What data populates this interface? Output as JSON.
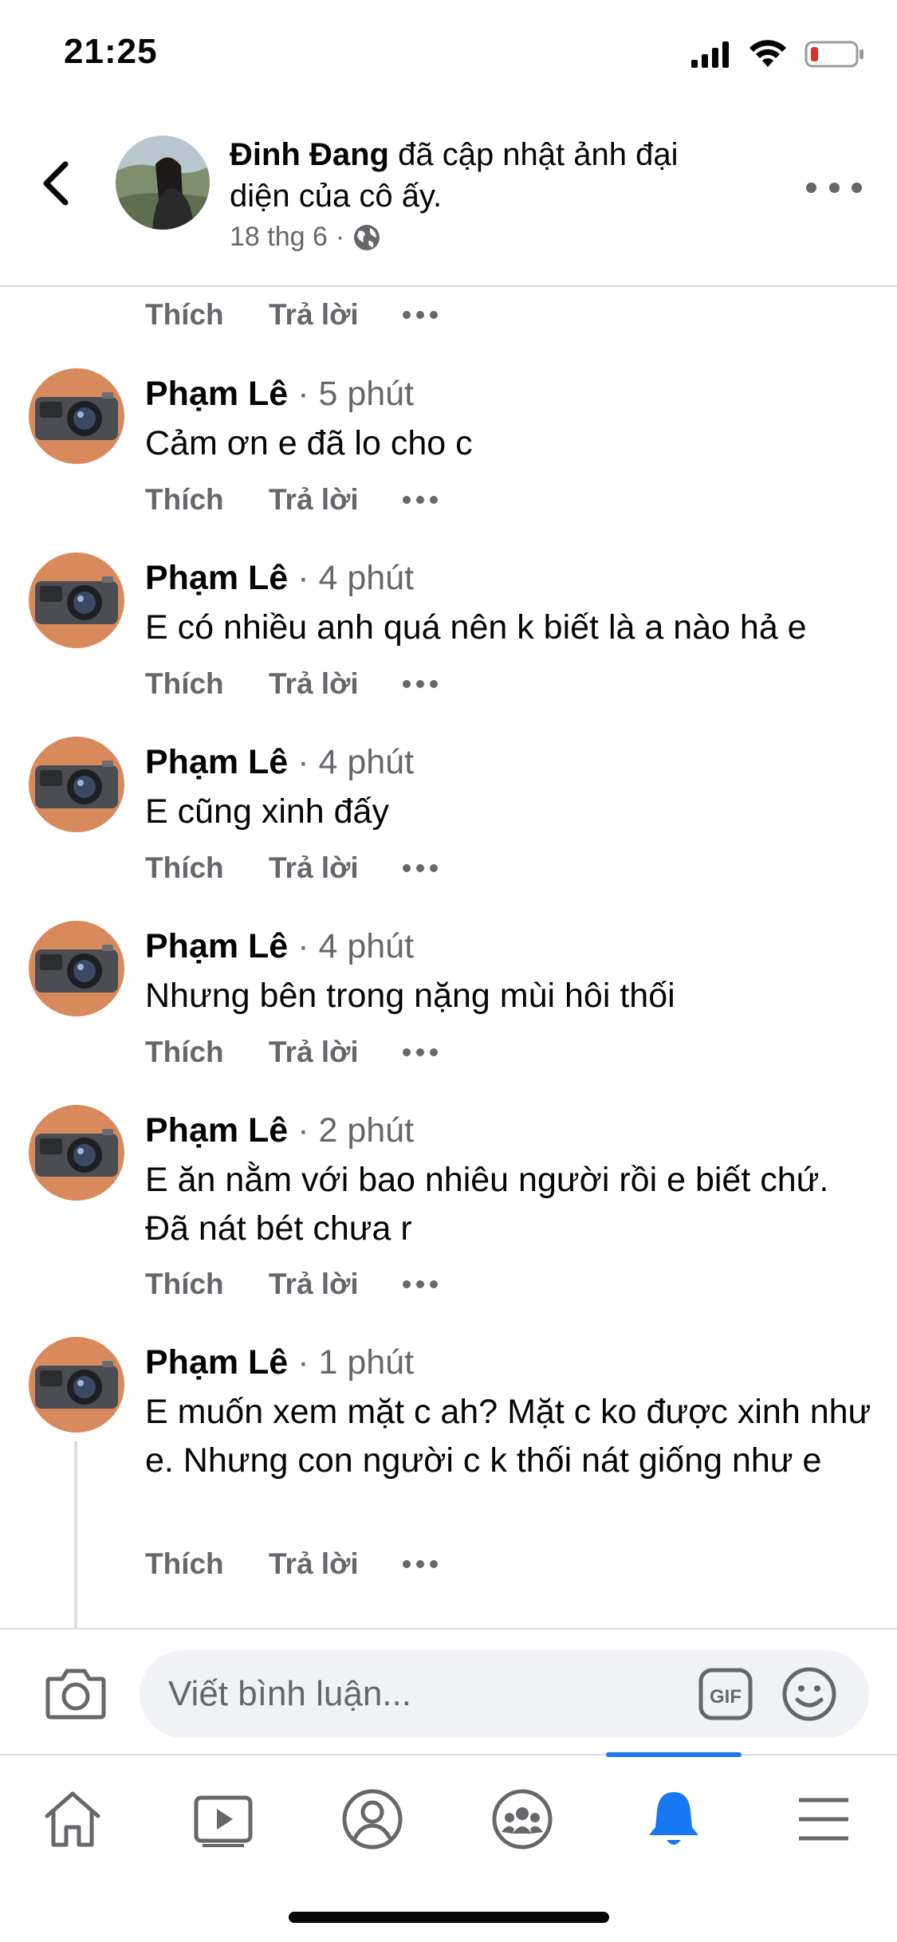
{
  "status_bar": {
    "time": "21:25",
    "icons": [
      "signal-icon",
      "wifi-icon",
      "battery-low-icon"
    ]
  },
  "header": {
    "author": "Đinh Đang",
    "action_text": " đã cập nhật ảnh đại diện của cô ấy.",
    "date": "18 thg 6",
    "separator": "·",
    "icons": [
      "back-chevron-icon",
      "globe-icon",
      "more-options-icon"
    ]
  },
  "actions": {
    "like": "Thích",
    "reply": "Trả lời"
  },
  "comments": [
    {
      "author": "Phạm Lê",
      "sep": "·",
      "time": "5 phút",
      "text": "Cảm ơn e đã lo cho c"
    },
    {
      "author": "Phạm Lê",
      "sep": "·",
      "time": "4 phút",
      "text": "E  có nhiều anh quá nên k biết là a nào hả e"
    },
    {
      "author": "Phạm Lê",
      "sep": "·",
      "time": "4 phút",
      "text": "E cũng xinh đấy"
    },
    {
      "author": "Phạm Lê",
      "sep": "·",
      "time": "4 phút",
      "text": "Nhưng bên trong nặng mùi hôi thối"
    },
    {
      "author": "Phạm Lê",
      "sep": "·",
      "time": "2 phút",
      "text": "E ăn nằm với bao nhiêu người rồi e biết chứ. Đã nát bét chưa r"
    },
    {
      "author": "Phạm Lê",
      "sep": "·",
      "time": "1 phút",
      "text": "E muốn xem mặt c ah? Mặt c ko được xinh như e. Nhưng con  người c k thối nát giống như e"
    }
  ],
  "composer": {
    "placeholder": "Viết bình luận...",
    "gif_label": "GIF"
  },
  "tabbar": {
    "tabs": [
      "home-icon",
      "video-icon",
      "profile-icon",
      "groups-icon",
      "notifications-icon",
      "menu-icon"
    ],
    "active": "notifications-icon"
  },
  "colors": {
    "accent": "#1877f2",
    "secondary_text": "#65676b",
    "divider": "#dadde1",
    "input_bg": "#f0f2f5"
  }
}
